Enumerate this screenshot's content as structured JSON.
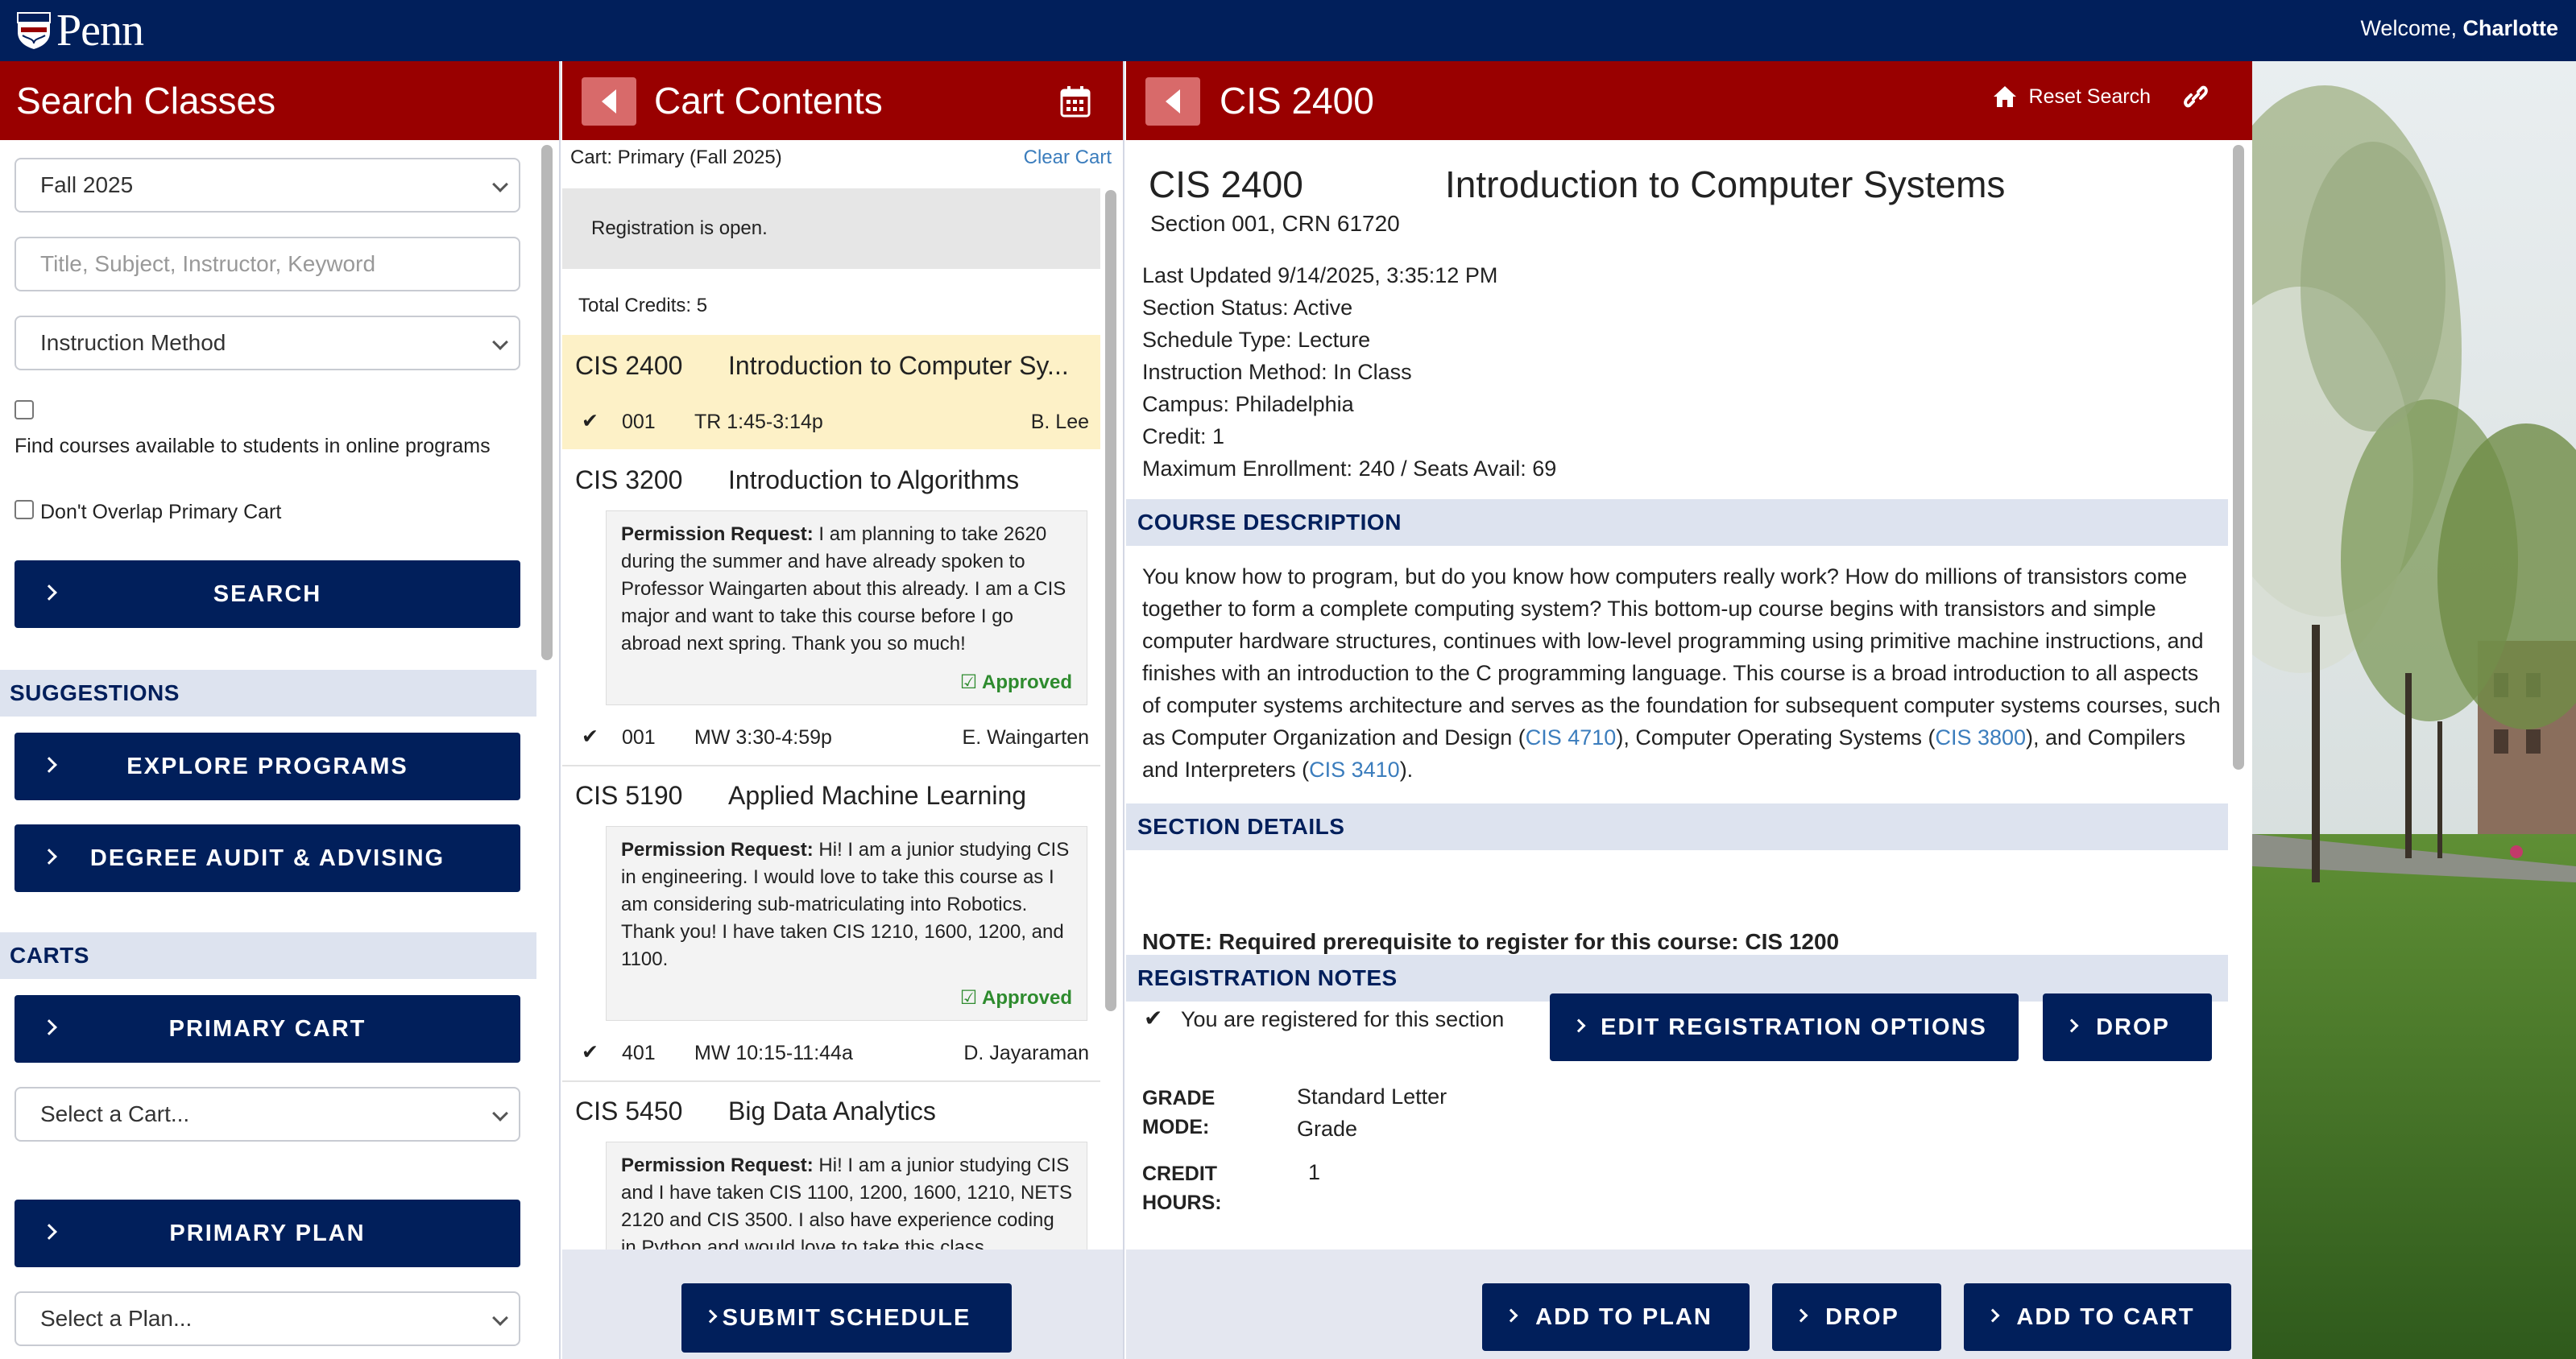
{
  "topbar": {
    "logo_text": "Penn",
    "welcome_prefix": "Welcome, ",
    "welcome_name": "Charlotte"
  },
  "search_panel": {
    "title": "Search Classes",
    "term_value": "Fall 2025",
    "keyword_placeholder": "Title, Subject, Instructor, Keyword",
    "method_value": "Instruction Method",
    "online_label": "Find courses available to students in online programs",
    "overlap_label": "Don't Overlap Primary Cart",
    "search_button": "SEARCH",
    "suggestions_header": "SUGGESTIONS",
    "explore_button": "EXPLORE PROGRAMS",
    "audit_button": "DEGREE AUDIT & ADVISING",
    "carts_header": "CARTS",
    "primary_cart_button": "PRIMARY CART",
    "cart_select": "Select a Cart...",
    "primary_plan_button": "PRIMARY PLAN",
    "plan_select": "Select a Plan..."
  },
  "cart_panel": {
    "title": "Cart Contents",
    "cart_label": "Cart: Primary (Fall 2025)",
    "clear_cart": "Clear Cart",
    "registration_status": "Registration is open.",
    "total_credits": "Total Credits: 5",
    "courses": [
      {
        "code": "CIS 2400",
        "name": "Introduction to Computer Sy...",
        "section": "001",
        "time": "TR 1:45-3:14p",
        "instructor": "B. Lee"
      },
      {
        "code": "CIS 3200",
        "name": "Introduction to Algorithms",
        "perm_label": "Permission Request:",
        "perm_text": " I am planning to take 2620 during the summer and have already spoken to Professor Waingarten about this already. I am a CIS major and want to take this course before I go abroad next spring. Thank you so much!",
        "status": "Approved",
        "section": "001",
        "time": "MW 3:30-4:59p",
        "instructor": "E. Waingarten"
      },
      {
        "code": "CIS 5190",
        "name": "Applied Machine Learning",
        "perm_label": "Permission Request:",
        "perm_text": " Hi! I am a junior studying CIS in engineering. I would love to take this course as I am considering sub-matriculating into Robotics. Thank you! I have taken CIS 1210, 1600, 1200, and 1100.",
        "status": "Approved",
        "section": "401",
        "time": "MW 10:15-11:44a",
        "instructor": "D. Jayaraman"
      },
      {
        "code": "CIS 5450",
        "name": "Big Data Analytics",
        "perm_label": "Permission Request:",
        "perm_text": " Hi! I am a junior studying CIS and I have taken CIS 1100, 1200, 1600, 1210, NETS 2120 and CIS 3500. I also have experience coding in Python and would love to take this class"
      }
    ],
    "submit_button": "SUBMIT SCHEDULE"
  },
  "detail_panel": {
    "header_title": "CIS 2400",
    "reset_search": "Reset Search",
    "code": "CIS 2400",
    "title": "Introduction to Computer Systems",
    "section_line": "Section 001, CRN 61720",
    "meta": [
      "Last Updated 9/14/2025, 3:35:12 PM",
      "Section Status: Active",
      "Schedule Type: Lecture",
      "Instruction Method: In Class",
      "Campus: Philadelphia",
      "Credit: 1",
      "Maximum Enrollment: 240 / Seats Avail: 69"
    ],
    "desc_header": "COURSE DESCRIPTION",
    "desc_part1": "You know how to program, but do you know how computers really work? How do millions of transistors come together to form a complete computing system? This bottom-up course begins with transistors and simple computer hardware structures, continues with low-level programming using primitive machine instructions, and finishes with an introduction to the C programming language. This course is a broad introduction to all aspects of computer systems architecture and serves as the foundation for subsequent computer systems courses, such as Computer Organization and Design (",
    "link1": "CIS 4710",
    "desc_part2": "), Computer Operating Systems (",
    "link2": "CIS 3800",
    "desc_part3": "), and Compilers and Interpreters (",
    "link3": "CIS 3410",
    "desc_part4": ").",
    "section_header": "SECTION DETAILS",
    "note": "NOTE: Required prerequisite to register for this course: CIS 1200",
    "reg_header": "REGISTRATION NOTES",
    "registered_text": "You are registered for this section",
    "edit_button": "EDIT REGISTRATION OPTIONS",
    "drop_button": "DROP",
    "grade_label_1": "GRADE",
    "grade_label_2": "MODE:",
    "grade_value": "Standard Letter Grade",
    "credit_label_1": "CREDIT",
    "credit_label_2": "HOURS:",
    "credit_value": "1",
    "add_plan_button": "ADD TO PLAN",
    "footer_drop_button": "DROP",
    "add_cart_button": "ADD TO CART"
  },
  "colors": {
    "navy": "#011f5b",
    "penn_red": "#990000",
    "highlight": "#fdf1c7",
    "approved": "#2e8b2e",
    "link": "#3b7dbd"
  }
}
